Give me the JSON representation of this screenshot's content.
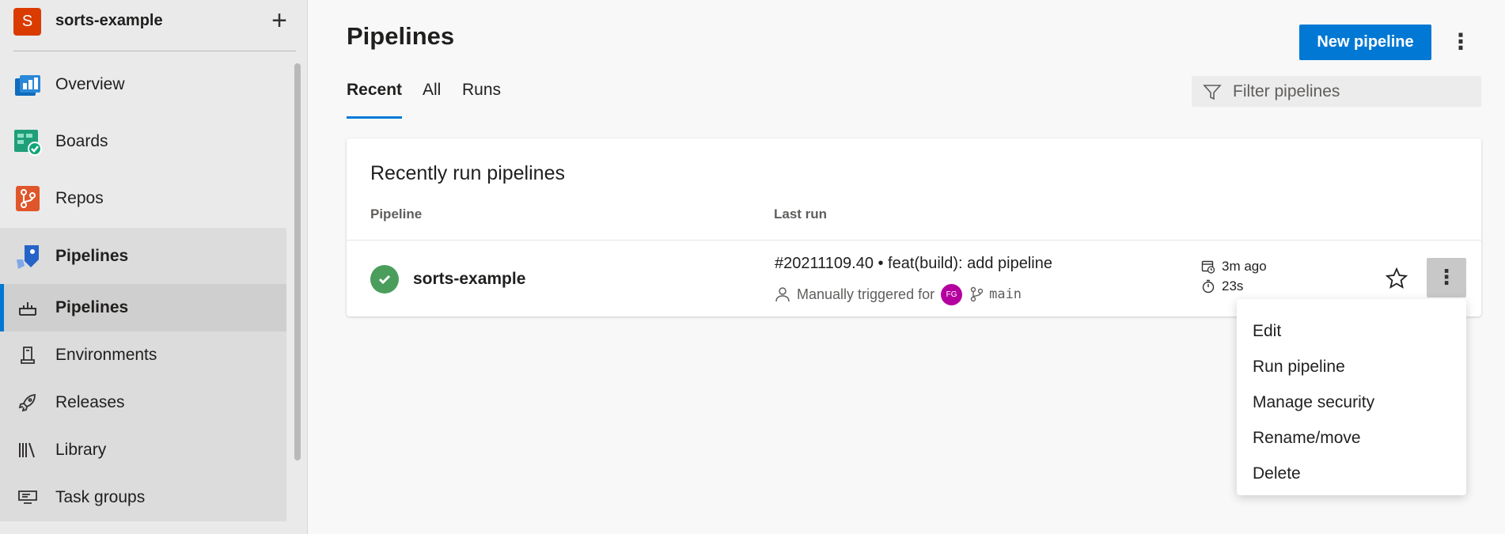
{
  "project": {
    "avatar_letter": "S",
    "name": "sorts-example",
    "add_label": "+"
  },
  "sidebar": {
    "items": [
      {
        "label": "Overview",
        "icon": "overview-icon"
      },
      {
        "label": "Boards",
        "icon": "boards-icon"
      },
      {
        "label": "Repos",
        "icon": "repos-icon"
      },
      {
        "label": "Pipelines",
        "icon": "pipelines-icon"
      }
    ],
    "sub_items": [
      {
        "label": "Pipelines",
        "icon": "pipelines-sub-icon"
      },
      {
        "label": "Environments",
        "icon": "environments-icon"
      },
      {
        "label": "Releases",
        "icon": "releases-icon"
      },
      {
        "label": "Library",
        "icon": "library-icon"
      },
      {
        "label": "Task groups",
        "icon": "task-groups-icon"
      }
    ]
  },
  "page": {
    "title": "Pipelines",
    "new_button": "New pipeline",
    "more": "⋮"
  },
  "tabs": [
    "Recent",
    "All",
    "Runs"
  ],
  "filter": {
    "placeholder": "Filter pipelines"
  },
  "card": {
    "title": "Recently run pipelines",
    "col_pipeline": "Pipeline",
    "col_last_run": "Last run",
    "row": {
      "name": "sorts-example",
      "run_title": "#20211109.40 • feat(build): add pipeline",
      "trigger": "Manually triggered for",
      "user_initials": "FG",
      "branch": "main",
      "ago": "3m ago",
      "duration": "23s",
      "more": "⋮"
    }
  },
  "menu": {
    "items": [
      "Edit",
      "Run pipeline",
      "Manage security",
      "Rename/move",
      "Delete"
    ]
  },
  "colors": {
    "accent": "#0078d4",
    "success": "#4a9d5b",
    "project": "#da3b01",
    "user_avatar": "#b4009e"
  }
}
